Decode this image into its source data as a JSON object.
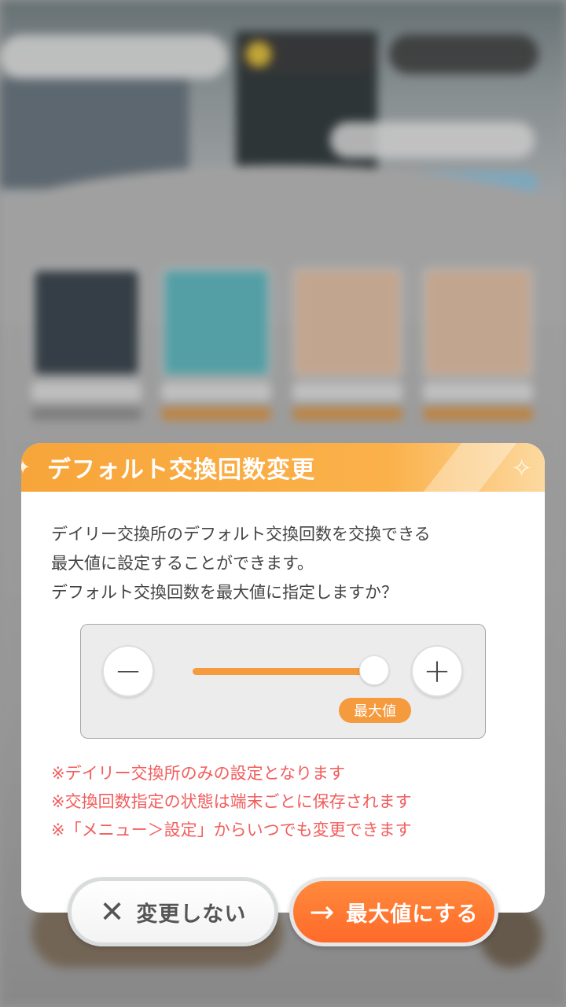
{
  "dialog": {
    "title": "デフォルト交換回数変更",
    "description_lines": [
      "デイリー交換所のデフォルト交換回数を交換できる",
      "最大値に設定することができます。",
      "デフォルト交換回数を最大値に指定しますか？"
    ],
    "slider": {
      "value_label": "最大値",
      "fill": 1.0,
      "minus_symbol": "−",
      "plus_symbol": "+"
    },
    "notes": [
      "※デイリー交換所のみの設定となります",
      "※交換回数指定の状態は端末ごとに保存されます",
      "※「メニュー＞設定」からいつでも変更できます"
    ],
    "accent_color": "#f59a3d",
    "note_color": "#f25d5d"
  },
  "actions": {
    "cancel_label": "変更しない",
    "cancel_icon": "close-icon",
    "confirm_label": "最大値にする",
    "confirm_icon": "arrow-right-icon"
  }
}
